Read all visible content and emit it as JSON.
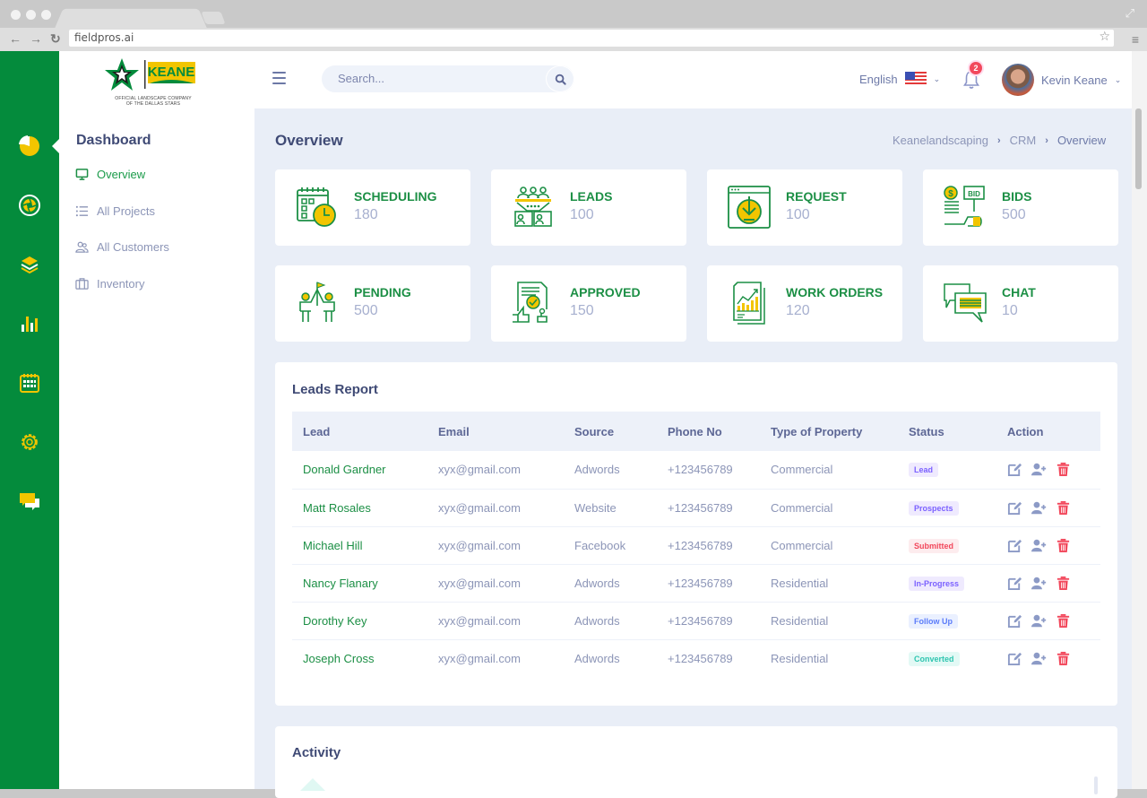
{
  "browser": {
    "url": "fieldpros.ai"
  },
  "brand": {
    "logo_tagline_1": "OFFICIAL LANDSCAPE COMPANY",
    "logo_tagline_2": "OF THE DALLAS STARS",
    "logo_word": "KEANE",
    "rail_color": "#048b3c",
    "accent_yellow": "#f2c500",
    "accent_green": "#1c8f45"
  },
  "rail": {
    "items": [
      {
        "icon": "pie-chart-icon"
      },
      {
        "icon": "aperture-icon"
      },
      {
        "icon": "layers-icon"
      },
      {
        "icon": "bar-chart-icon"
      },
      {
        "icon": "calendar-icon"
      },
      {
        "icon": "gear-icon"
      },
      {
        "icon": "chat-icon"
      }
    ]
  },
  "sidebar": {
    "title": "Dashboard",
    "items": [
      {
        "label": "Overview",
        "icon": "monitor-icon",
        "active": true
      },
      {
        "label": "All Projects",
        "icon": "list-icon"
      },
      {
        "label": "All Customers",
        "icon": "users-icon"
      },
      {
        "label": "Inventory",
        "icon": "briefcase-icon"
      }
    ]
  },
  "topbar": {
    "search_placeholder": "Search...",
    "language": "English",
    "notifications_count": "2",
    "user_name": "Kevin Keane"
  },
  "page": {
    "title": "Overview",
    "breadcrumb": [
      "Keanelandscaping",
      "CRM",
      "Overview"
    ]
  },
  "cards": [
    {
      "label": "SCHEDULING",
      "value": "180",
      "icon": "calendar-clock-icon"
    },
    {
      "label": "LEADS",
      "value": "100",
      "icon": "leads-funnel-icon"
    },
    {
      "label": "REQUEST",
      "value": "100",
      "icon": "request-download-icon"
    },
    {
      "label": "BIDS",
      "value": "500",
      "icon": "bid-sign-icon"
    },
    {
      "label": "PENDING",
      "value": "500",
      "icon": "team-flag-icon"
    },
    {
      "label": "APPROVED",
      "value": "150",
      "icon": "approved-stamp-icon"
    },
    {
      "label": "WORK ORDERS",
      "value": "120",
      "icon": "report-chart-icon"
    },
    {
      "label": "CHAT",
      "value": "10",
      "icon": "chat-bubbles-icon"
    }
  ],
  "leads_report": {
    "title": "Leads Report",
    "columns": [
      "Lead",
      "Email",
      "Source",
      "Phone No",
      "Type of Property",
      "Status",
      "Action"
    ],
    "rows": [
      {
        "lead": "Donald Gardner",
        "email": "xyx@gmail.com",
        "source": "Adwords",
        "phone": "+123456789",
        "property": "Commercial",
        "status": "Lead",
        "status_fg": "#7b61ff",
        "status_bg": "#efeafe"
      },
      {
        "lead": "Matt Rosales",
        "email": "xyx@gmail.com",
        "source": "Website",
        "phone": "+123456789",
        "property": "Commercial",
        "status": "Prospects",
        "status_fg": "#7b61ff",
        "status_bg": "#efeafe"
      },
      {
        "lead": "Michael Hill",
        "email": "xyx@gmail.com",
        "source": "Facebook",
        "phone": "+123456789",
        "property": "Commercial",
        "status": "Submitted",
        "status_fg": "#f2485c",
        "status_bg": "#fdecee"
      },
      {
        "lead": "Nancy Flanary",
        "email": "xyx@gmail.com",
        "source": "Adwords",
        "phone": "+123456789",
        "property": "Residential",
        "status": "In-Progress",
        "status_fg": "#7b61ff",
        "status_bg": "#efeafe"
      },
      {
        "lead": "Dorothy Key",
        "email": "xyx@gmail.com",
        "source": "Adwords",
        "phone": "+123456789",
        "property": "Residential",
        "status": "Follow Up",
        "status_fg": "#5b7cfa",
        "status_bg": "#eaf0ff"
      },
      {
        "lead": "Joseph Cross",
        "email": "xyx@gmail.com",
        "source": "Adwords",
        "phone": "+123456789",
        "property": "Residential",
        "status": "Converted",
        "status_fg": "#2fc5b0",
        "status_bg": "#e3f9f5"
      }
    ]
  },
  "activity": {
    "title": "Activity"
  }
}
